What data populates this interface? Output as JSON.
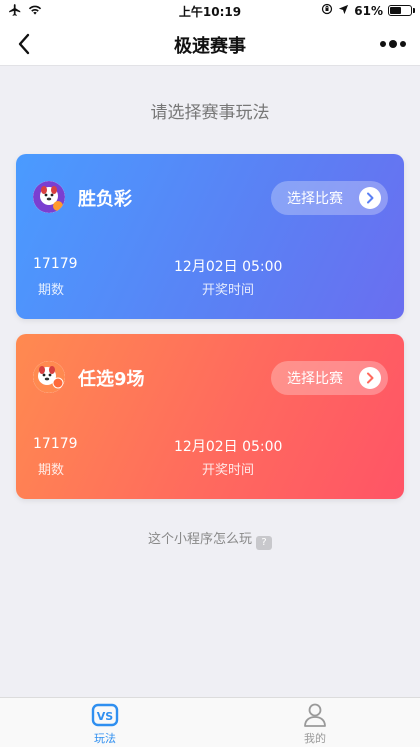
{
  "status_bar": {
    "time": "上午10:19",
    "battery_text": "61%",
    "battery_level": 0.61
  },
  "nav": {
    "title": "极速赛事"
  },
  "main": {
    "prompt": "请选择赛事玩法",
    "cards": [
      {
        "name": "胜负彩",
        "button_label": "选择比赛",
        "period_value": "17179",
        "period_label": "期数",
        "time_value": "12月02日 05:00",
        "time_label": "开奖时间"
      },
      {
        "name": "任选9场",
        "button_label": "选择比赛",
        "period_value": "17179",
        "period_label": "期数",
        "time_value": "12月02日 05:00",
        "time_label": "开奖时间"
      }
    ],
    "help_text": "这个小程序怎么玩",
    "help_icon_text": "?"
  },
  "tab_bar": {
    "tabs": [
      {
        "label": "玩法",
        "icon_text": "VS",
        "icon": "vs-icon",
        "active": true
      },
      {
        "label": "我的",
        "icon": "user-icon",
        "active": false
      }
    ]
  },
  "colors": {
    "accent": "#2f8ff0",
    "inactive": "#9a9a9a",
    "card1_start": "#4a9bff",
    "card1_end": "#6a6ef0",
    "card2_start": "#ff8a50",
    "card2_end": "#ff5466"
  }
}
